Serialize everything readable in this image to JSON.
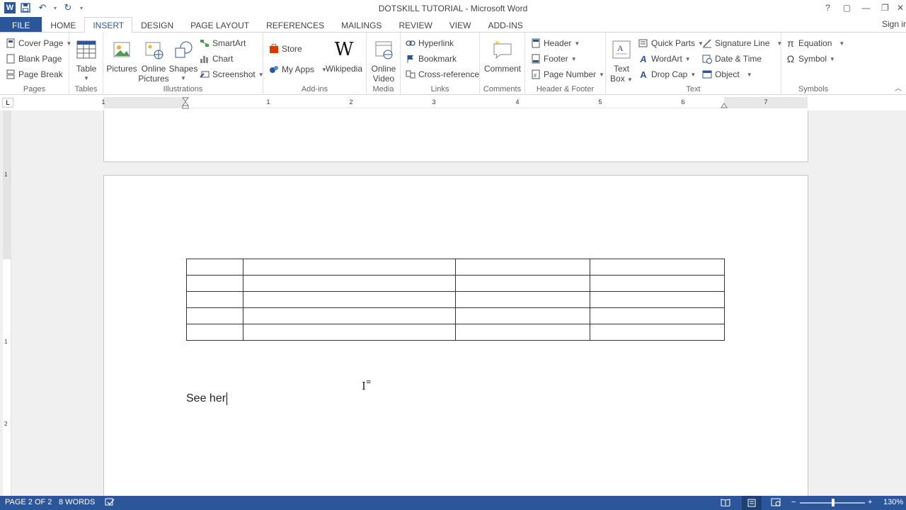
{
  "window": {
    "title": "DOTSKILL TUTORIAL - Microsoft Word",
    "help": "?",
    "ribbon_display": "▢",
    "minimize": "—",
    "restore": "❐",
    "close": "✕",
    "sign_in": "Sign in"
  },
  "qat": {
    "word_logo": "W",
    "save": "💾",
    "undo": "↶",
    "redo": "↻",
    "customize": "▾"
  },
  "tabs": [
    "FILE",
    "HOME",
    "INSERT",
    "DESIGN",
    "PAGE LAYOUT",
    "REFERENCES",
    "MAILINGS",
    "REVIEW",
    "VIEW",
    "ADD-INS"
  ],
  "active_tab": "INSERT",
  "ribbon": {
    "pages": {
      "label": "Pages",
      "cover_page": "Cover Page",
      "blank_page": "Blank Page",
      "page_break": "Page Break"
    },
    "tables": {
      "label": "Tables",
      "table": "Table"
    },
    "illustrations": {
      "label": "Illustrations",
      "pictures": "Pictures",
      "online_pictures_1": "Online",
      "online_pictures_2": "Pictures",
      "shapes": "Shapes",
      "smartart": "SmartArt",
      "chart": "Chart",
      "screenshot": "Screenshot"
    },
    "addins": {
      "label": "Add-ins",
      "store": "Store",
      "my_apps": "My Apps",
      "wikipedia": "Wikipedia"
    },
    "media": {
      "label": "Media",
      "online_video_1": "Online",
      "online_video_2": "Video"
    },
    "links": {
      "label": "Links",
      "hyperlink": "Hyperlink",
      "bookmark": "Bookmark",
      "cross_reference": "Cross-reference"
    },
    "comments": {
      "label": "Comments",
      "comment": "Comment"
    },
    "header_footer": {
      "label": "Header & Footer",
      "header": "Header",
      "footer": "Footer",
      "page_number": "Page Number"
    },
    "text": {
      "label": "Text",
      "text_box_1": "Text",
      "text_box_2": "Box",
      "quick_parts": "Quick Parts",
      "wordart": "WordArt",
      "drop_cap": "Drop Cap",
      "signature_line": "Signature Line",
      "date_time": "Date & Time",
      "object": "Object"
    },
    "symbols": {
      "label": "Symbols",
      "equation": "Equation",
      "symbol": "Symbol",
      "equation_glyph": "π",
      "symbol_glyph": "Ω"
    }
  },
  "ruler": {
    "tab_selector": "L",
    "marks": [
      "1",
      "1",
      "2",
      "3",
      "4",
      "5",
      "6",
      "7"
    ],
    "vertical_marks": [
      "1",
      "1",
      "2"
    ]
  },
  "document": {
    "table": {
      "rows": 5,
      "cols": 4
    },
    "text": "See her"
  },
  "status": {
    "page": "PAGE 2 OF 2",
    "words": "8 WORDS",
    "zoom": "130%",
    "zoom_minus": "−",
    "zoom_plus": "+"
  },
  "colors": {
    "accent": "#2b579a",
    "statusbar": "#2b579a"
  }
}
